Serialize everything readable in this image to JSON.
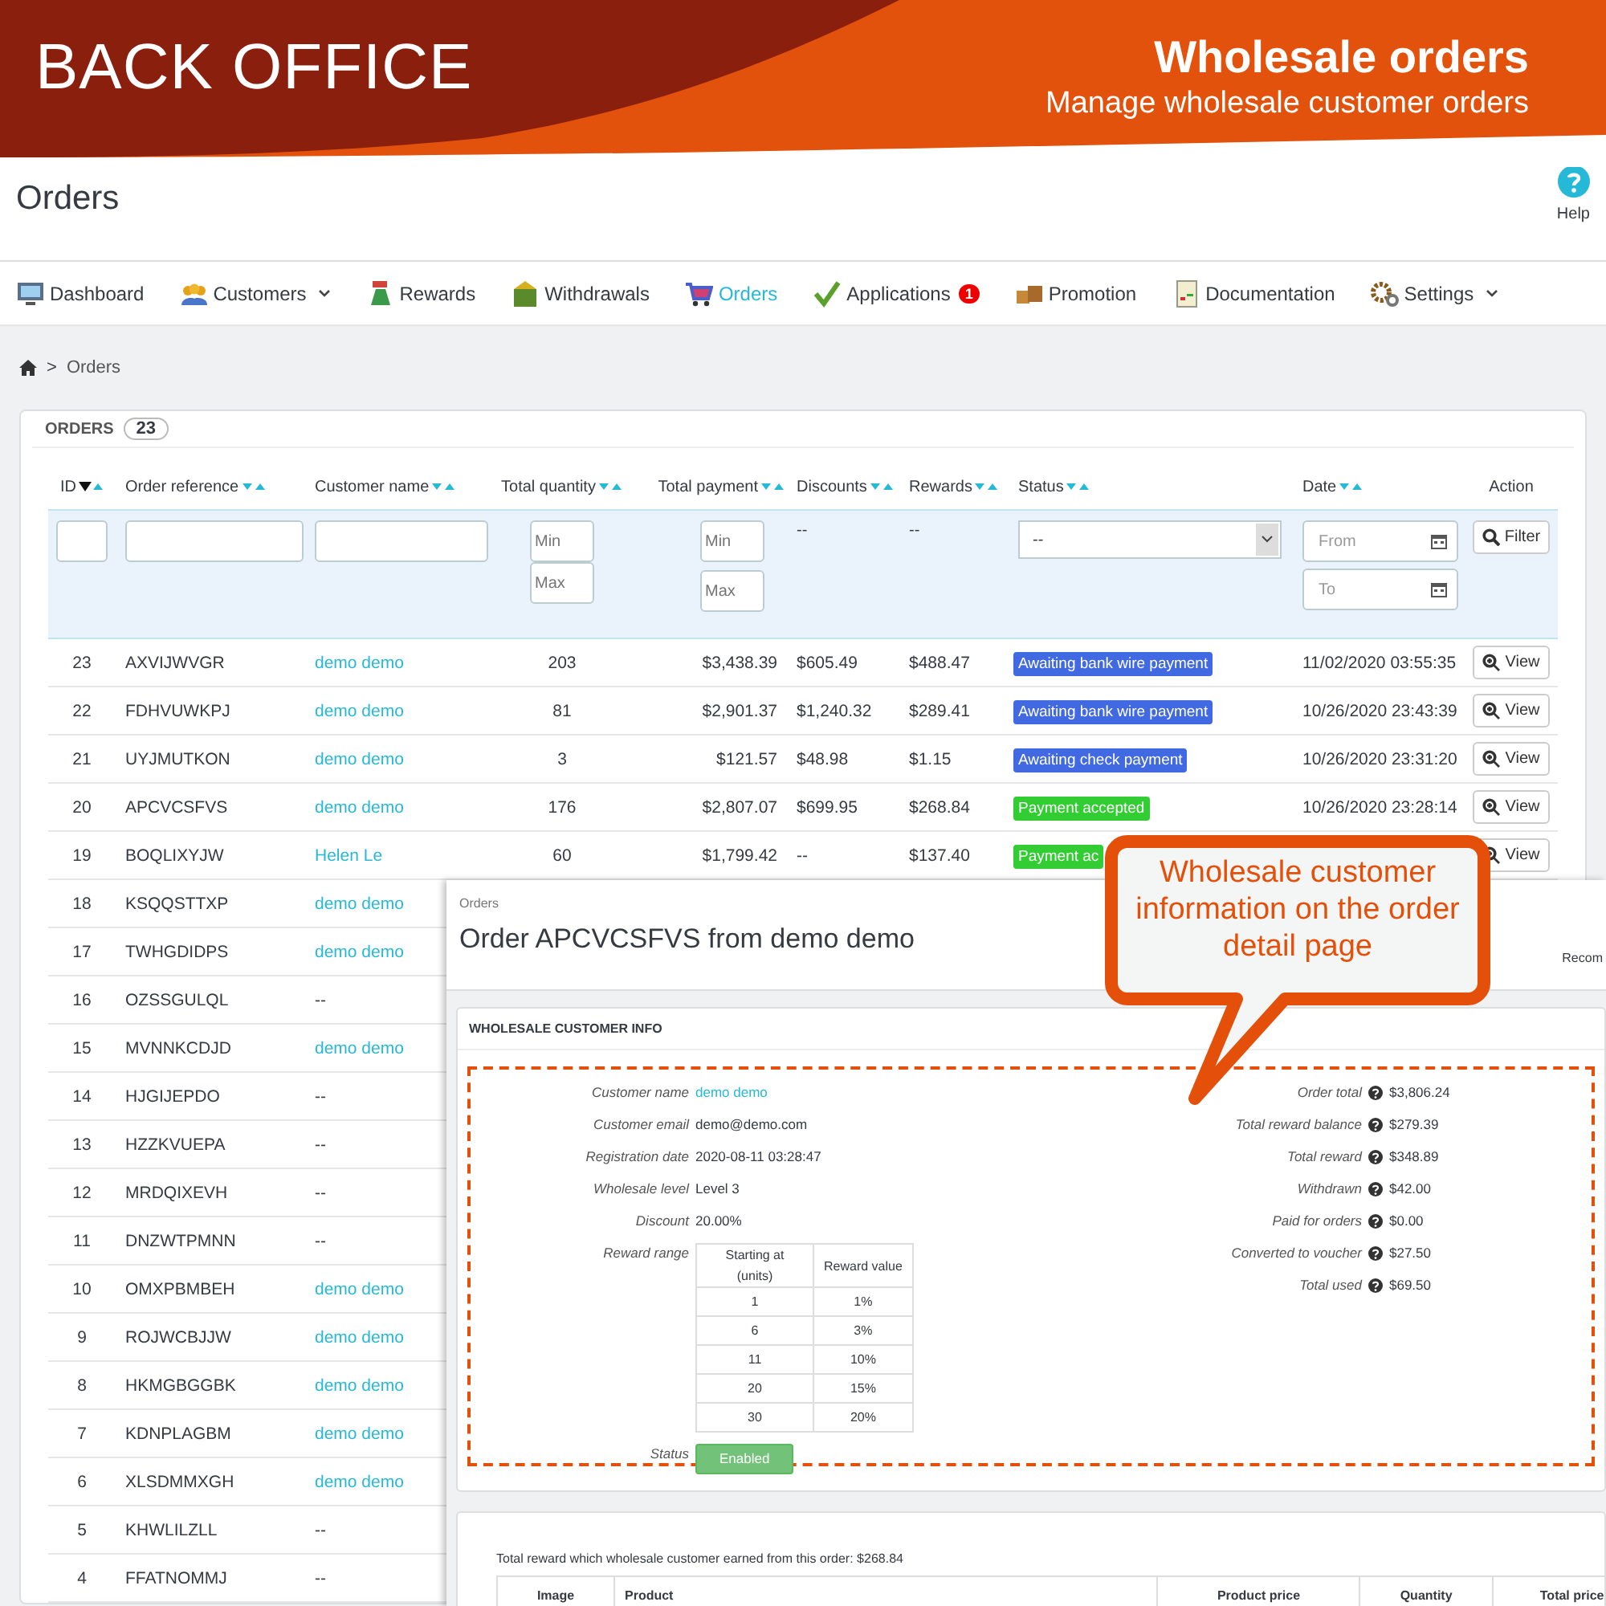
{
  "banner": {
    "left_title": "BACK OFFICE",
    "title": "Wholesale orders",
    "subtitle": "Manage wholesale customer orders"
  },
  "header": {
    "title": "Orders",
    "help_label": "Help"
  },
  "nav": [
    {
      "label": "Dashboard",
      "selected": false,
      "has_menu": false
    },
    {
      "label": "Customers",
      "selected": false,
      "has_menu": true
    },
    {
      "label": "Rewards",
      "selected": false,
      "has_menu": false
    },
    {
      "label": "Withdrawals",
      "selected": false,
      "has_menu": false
    },
    {
      "label": "Orders",
      "selected": true,
      "has_menu": false
    },
    {
      "label": "Applications",
      "selected": false,
      "has_menu": false,
      "badge": "1"
    },
    {
      "label": "Promotion",
      "selected": false,
      "has_menu": false
    },
    {
      "label": "Documentation",
      "selected": false,
      "has_menu": false
    },
    {
      "label": "Settings",
      "selected": false,
      "has_menu": true
    }
  ],
  "breadcrumb": {
    "separator": ">",
    "current": "Orders"
  },
  "orders_panel": {
    "title": "ORDERS",
    "count": "23",
    "columns": [
      {
        "label": "ID",
        "sortable": true,
        "sort_active": true
      },
      {
        "label": "Order reference",
        "sortable": true,
        "sort_active": false
      },
      {
        "label": "Customer name",
        "sortable": true,
        "sort_active": false
      },
      {
        "label": "Total quantity",
        "sortable": true,
        "sort_active": false
      },
      {
        "label": "Total payment",
        "sortable": true,
        "sort_active": false
      },
      {
        "label": "Discounts",
        "sortable": true,
        "sort_active": false
      },
      {
        "label": "Rewards",
        "sortable": true,
        "sort_active": false
      },
      {
        "label": "Status",
        "sortable": true,
        "sort_active": false
      },
      {
        "label": "Date",
        "sortable": true,
        "sort_active": false
      },
      {
        "label": "Action",
        "sortable": false
      }
    ],
    "filters": [
      {
        "kind": "text"
      },
      {
        "kind": "text"
      },
      {
        "kind": "text"
      },
      {
        "kind": "range",
        "placeholders": [
          "Min",
          "Max"
        ]
      },
      {
        "kind": "range",
        "placeholders": [
          "Min",
          "Max"
        ]
      },
      {
        "kind": "none",
        "text": "--"
      },
      {
        "kind": "none",
        "text": "--"
      },
      {
        "kind": "select",
        "value": "--"
      },
      {
        "kind": "date",
        "placeholders": [
          "From",
          "To"
        ]
      },
      {
        "kind": "button",
        "label": "Filter"
      }
    ],
    "rows": [
      {
        "id": "23",
        "reference": "AXVIJWVGR",
        "customer": "demo demo",
        "customer_is_link": true,
        "quantity": "203",
        "payment": "$3,438.39",
        "discounts": "$605.49",
        "rewards": "$488.47",
        "status": {
          "label": "Awaiting bank wire payment",
          "color": "#4169e1"
        },
        "date": "11/02/2020 03:55:35",
        "action": "View"
      },
      {
        "id": "22",
        "reference": "FDHVUWKPJ",
        "customer": "demo demo",
        "customer_is_link": true,
        "quantity": "81",
        "payment": "$2,901.37",
        "discounts": "$1,240.32",
        "rewards": "$289.41",
        "status": {
          "label": "Awaiting bank wire payment",
          "color": "#4169e1"
        },
        "date": "10/26/2020 23:43:39",
        "action": "View"
      },
      {
        "id": "21",
        "reference": "UYJMUTKON",
        "customer": "demo demo",
        "customer_is_link": true,
        "quantity": "3",
        "payment": "$121.57",
        "discounts": "$48.98",
        "rewards": "$1.15",
        "status": {
          "label": "Awaiting check payment",
          "color": "#4169e1"
        },
        "date": "10/26/2020 23:31:20",
        "action": "View"
      },
      {
        "id": "20",
        "reference": "APCVCSFVS",
        "customer": "demo demo",
        "customer_is_link": true,
        "quantity": "176",
        "payment": "$2,807.07",
        "discounts": "$699.95",
        "rewards": "$268.84",
        "status": {
          "label": "Payment accepted",
          "color": "#32cd32"
        },
        "date": "10/26/2020 23:28:14",
        "action": "View"
      },
      {
        "id": "19",
        "reference": "BOQLIXYJW",
        "customer": "Helen Le",
        "customer_is_link": true,
        "quantity": "60",
        "payment": "$1,799.42",
        "discounts": "--",
        "rewards": "$137.40",
        "status": {
          "label": "Payment ac",
          "color": "#32cd32"
        },
        "action": "View"
      },
      {
        "id": "18",
        "reference": "KSQQSTTXP",
        "customer": "demo demo",
        "customer_is_link": true
      },
      {
        "id": "17",
        "reference": "TWHGDIDPS",
        "customer": "demo demo",
        "customer_is_link": true
      },
      {
        "id": "16",
        "reference": "OZSSGULQL",
        "customer": "--",
        "customer_is_link": false
      },
      {
        "id": "15",
        "reference": "MVNNKCDJD",
        "customer": "demo demo",
        "customer_is_link": true
      },
      {
        "id": "14",
        "reference": "HJGIJEPDO",
        "customer": "--",
        "customer_is_link": false
      },
      {
        "id": "13",
        "reference": "HZZKVUEPA",
        "customer": "--",
        "customer_is_link": false
      },
      {
        "id": "12",
        "reference": "MRDQIXEVH",
        "customer": "--",
        "customer_is_link": false
      },
      {
        "id": "11",
        "reference": "DNZWTPMNN",
        "customer": "--",
        "customer_is_link": false
      },
      {
        "id": "10",
        "reference": "OMXPBMBEH",
        "customer": "demo demo",
        "customer_is_link": true
      },
      {
        "id": "9",
        "reference": "ROJWCBJJW",
        "customer": "demo demo",
        "customer_is_link": true
      },
      {
        "id": "8",
        "reference": "HKMGBGGBK",
        "customer": "demo demo",
        "customer_is_link": true
      },
      {
        "id": "7",
        "reference": "KDNPLAGBM",
        "customer": "demo demo",
        "customer_is_link": true
      },
      {
        "id": "6",
        "reference": "XLSDMMXGH",
        "customer": "demo demo",
        "customer_is_link": true
      },
      {
        "id": "5",
        "reference": "KHWLILZLL",
        "customer": "--",
        "customer_is_link": false
      },
      {
        "id": "4",
        "reference": "FFATNOMMJ",
        "customer": "--",
        "customer_is_link": false
      }
    ]
  },
  "order_detail": {
    "breadcrumb": "Orders",
    "title": "Order APCVCSFVS from demo demo",
    "toolbar_text": "Recom",
    "info_panel": {
      "title": "WHOLESALE CUSTOMER INFO",
      "left": [
        {
          "kind": "link",
          "label": "Customer name",
          "value": "demo demo"
        },
        {
          "kind": "text",
          "label": "Customer email",
          "value": "demo@demo.com"
        },
        {
          "kind": "text",
          "label": "Registration date",
          "value": "2020-08-11 03:28:47"
        },
        {
          "kind": "text",
          "label": "Wholesale level",
          "value": "Level 3"
        },
        {
          "kind": "text",
          "label": "Discount",
          "value": "20.00%"
        },
        {
          "kind": "table",
          "label": "Reward range",
          "columns": [
            "Starting at (units)",
            "Reward value"
          ],
          "rows": [
            [
              "1",
              "1%"
            ],
            [
              "6",
              "3%"
            ],
            [
              "11",
              "10%"
            ],
            [
              "20",
              "15%"
            ],
            [
              "30",
              "20%"
            ]
          ]
        },
        {
          "kind": "badge",
          "label": "Status",
          "value": "Enabled"
        }
      ],
      "right": [
        {
          "label": "Order total",
          "value": "$3,806.24"
        },
        {
          "label": "Total reward balance",
          "value": "$279.39"
        },
        {
          "label": "Total reward",
          "value": "$348.89"
        },
        {
          "label": "Withdrawn",
          "value": "$42.00"
        },
        {
          "label": "Paid for orders",
          "value": "$0.00"
        },
        {
          "label": "Converted to voucher",
          "value": "$27.50"
        },
        {
          "label": "Total used",
          "value": "$69.50"
        }
      ]
    },
    "products_panel": {
      "summary": "Total reward which wholesale customer earned from this order: $268.84",
      "columns": [
        "Image",
        "Product",
        "Product price",
        "Quantity",
        "Total price"
      ]
    }
  },
  "callout": {
    "text": "Wholesale customer information on the order detail page"
  }
}
